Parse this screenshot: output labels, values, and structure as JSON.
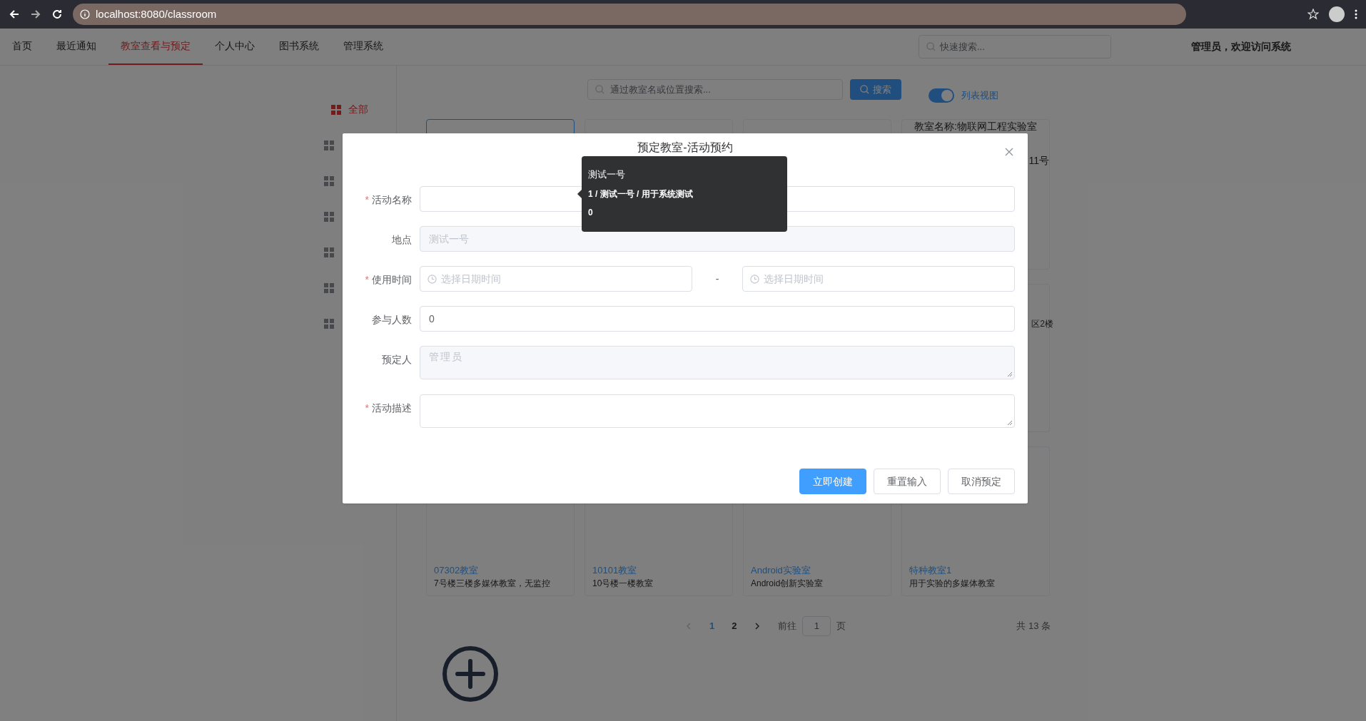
{
  "browser": {
    "url": "localhost:8080/classroom"
  },
  "nav": {
    "items": [
      {
        "label": "首页",
        "selected": false
      },
      {
        "label": "最近通知",
        "selected": false
      },
      {
        "label": "教室查看与预定",
        "selected": true
      },
      {
        "label": "个人中心",
        "selected": false
      },
      {
        "label": "图书系统",
        "selected": false
      },
      {
        "label": "管理系统",
        "selected": false
      }
    ],
    "search": {
      "placeholder": "快速搜索..."
    },
    "greeting": "管理员，欢迎访问系统"
  },
  "sidebar": {
    "items": [
      {
        "label": "全部",
        "selected": true
      },
      {
        "selected": false
      },
      {
        "selected": false
      },
      {
        "selected": false
      },
      {
        "selected": false
      },
      {
        "selected": false
      },
      {
        "selected": false
      }
    ]
  },
  "toolbar": {
    "search": {
      "placeholder": "通过教室名或位置搜索..."
    },
    "search_button": "搜索",
    "view_toggle": {
      "label": "列表视图",
      "on": true
    }
  },
  "cards_top": [
    {
      "selected": true
    },
    {
      "selected": false
    },
    {
      "selected": false
    },
    {
      "title": "教室名称:物联网工程实验室",
      "selected": false,
      "detail": "11号"
    }
  ],
  "card_middle": {
    "detail": "区2楼"
  },
  "cards_bottom": [
    {
      "name": "07302教室",
      "description": "7号楼三楼多媒体教室，无监控"
    },
    {
      "name": "10101教室",
      "description": "10号楼一楼教室"
    },
    {
      "name": "Android实验室",
      "description": "Android创新实验室"
    },
    {
      "name": "特种教室1",
      "description": "用于实验的多媒体教室"
    }
  ],
  "pagination": {
    "pages": [
      {
        "label": "1",
        "selected": true
      },
      {
        "label": "2",
        "selected": false
      }
    ],
    "goto_label": "前往",
    "goto_value": "1",
    "page_unit": "页",
    "total": "共 13 条"
  },
  "modal": {
    "title": "预定教室-活动预约",
    "required_symbol": "*",
    "fields": [
      {
        "kind": "input",
        "label": "活动名称",
        "required": true,
        "disabled": false
      },
      {
        "kind": "input",
        "label": "地点",
        "required": false,
        "disabled": true,
        "value": "测试一号"
      },
      {
        "kind": "daterange",
        "label": "使用时间",
        "required": true,
        "start_placeholder": "选择日期时间",
        "separator": "-",
        "end_placeholder": "选择日期时间"
      },
      {
        "kind": "input",
        "label": "参与人数",
        "required": false,
        "disabled": false,
        "value": "0"
      },
      {
        "kind": "textarea",
        "label": "预定人",
        "required": false,
        "disabled": true,
        "value": "管理员"
      },
      {
        "kind": "textarea",
        "label": "活动描述",
        "required": true,
        "disabled": false
      }
    ],
    "buttons": [
      {
        "label": "立即创建",
        "kind": "primary"
      },
      {
        "label": "重置输入",
        "kind": "plain"
      },
      {
        "label": "取消预定",
        "kind": "plain"
      }
    ]
  },
  "tooltip": {
    "title": "测试一号",
    "line": "1 / 测试一号 / 用于系统测试",
    "count": "0"
  }
}
